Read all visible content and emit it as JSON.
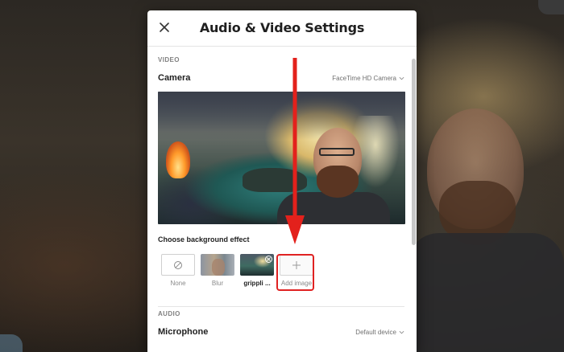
{
  "dialog": {
    "title": "Audio & Video Settings",
    "close_icon": "close-icon"
  },
  "video": {
    "section_label": "VIDEO",
    "camera_label": "Camera",
    "camera_selected": "FaceTime HD Camera",
    "background_heading": "Choose background effect",
    "effects": [
      {
        "label": "None",
        "icon": "none-icon"
      },
      {
        "label": "Blur"
      },
      {
        "label": "grippli ...",
        "badge_icon": "remove-icon"
      },
      {
        "label": "Add image",
        "icon": "plus-icon"
      }
    ]
  },
  "audio": {
    "section_label": "AUDIO",
    "microphone_label": "Microphone",
    "microphone_selected": "Default device"
  },
  "colors": {
    "highlight": "#e02222",
    "arrow": "#e3211c"
  }
}
